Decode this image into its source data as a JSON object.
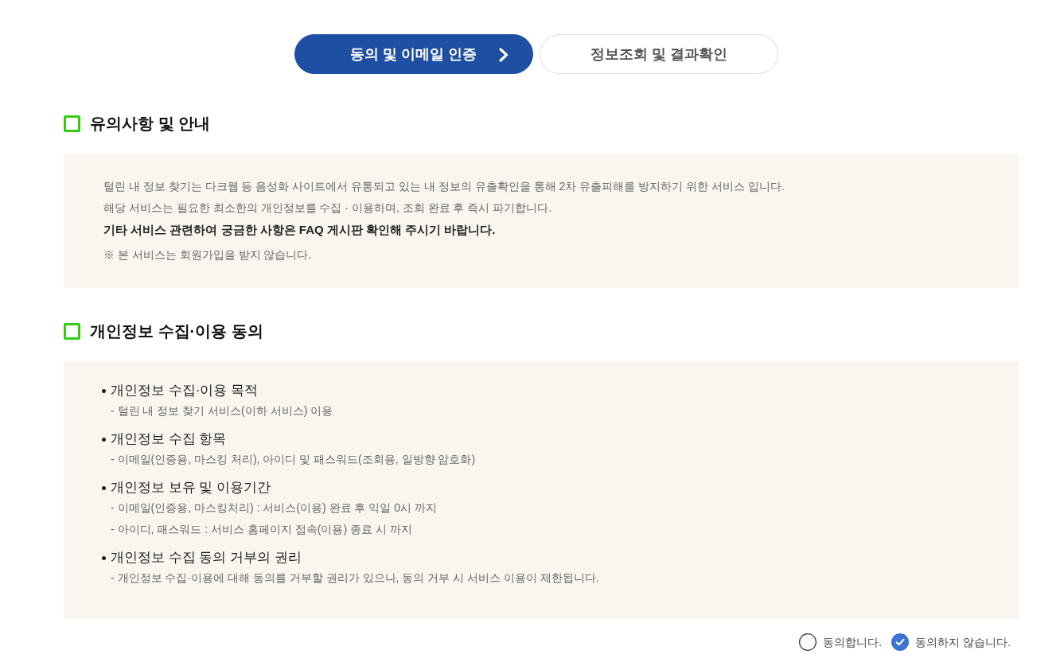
{
  "steps": [
    {
      "label": "동의 및 이메일 인증",
      "selected": true
    },
    {
      "label": "정보조회 및 결과확인",
      "selected": false
    }
  ],
  "notice": {
    "title": "유의사항 및 안내",
    "lines": [
      {
        "kind": "normal",
        "text": "털린 내 정보 찾기는 다크웹 등 음성화 사이트에서 유통되고 있는 내 정보의 유출확인을 통해 2차 유출피해를 방지하기 위한 서비스 입니다."
      },
      {
        "kind": "normal",
        "text": "해당 서비스는 필요한 최소한의 개인정보를 수집 · 이용하며, 조회 완료 후 즉시 파기합니다."
      },
      {
        "kind": "emphasis",
        "text": "기타 서비스 관련하여 궁금한 사항은 FAQ 게시판 확인해 주시기 바랍니다."
      },
      {
        "kind": "note",
        "text": "※ 본 서비스는 회원가입을 받지 않습니다."
      }
    ]
  },
  "consent": {
    "title": "개인정보 수집·이용 동의",
    "items": [
      {
        "heading": "개인정보 수집·이용 목적",
        "details": [
          "- 털린 내 정보 찾기 서비스(이하 서비스) 이용"
        ]
      },
      {
        "heading": "개인정보 수집 항목",
        "details": [
          "- 이메일(인증용, 마스킹 처리), 아이디 및 패스워드(조회용, 일방향 암호화)"
        ]
      },
      {
        "heading": "개인정보 보유 및 이용기간",
        "details": [
          "- 이메일(인증용, 마스킹처리) : 서비스(이용) 완료 후 익일 0시 까지",
          "- 아이디, 패스워드 : 서비스 홈페이지 접속(이용) 종료 시 까지"
        ]
      },
      {
        "heading": "개인정보 수집 동의 거부의 권리",
        "details": [
          "- 개인정보 수집·이용에 대해 동의를 거부할 권리가 있으나, 동의 거부 시 서비스 이용이 제한됩니다."
        ]
      }
    ]
  },
  "agreement": {
    "options": [
      {
        "label": "동의합니다.",
        "selected": false
      },
      {
        "label": "동의하지 않습니다.",
        "selected": true
      }
    ]
  }
}
